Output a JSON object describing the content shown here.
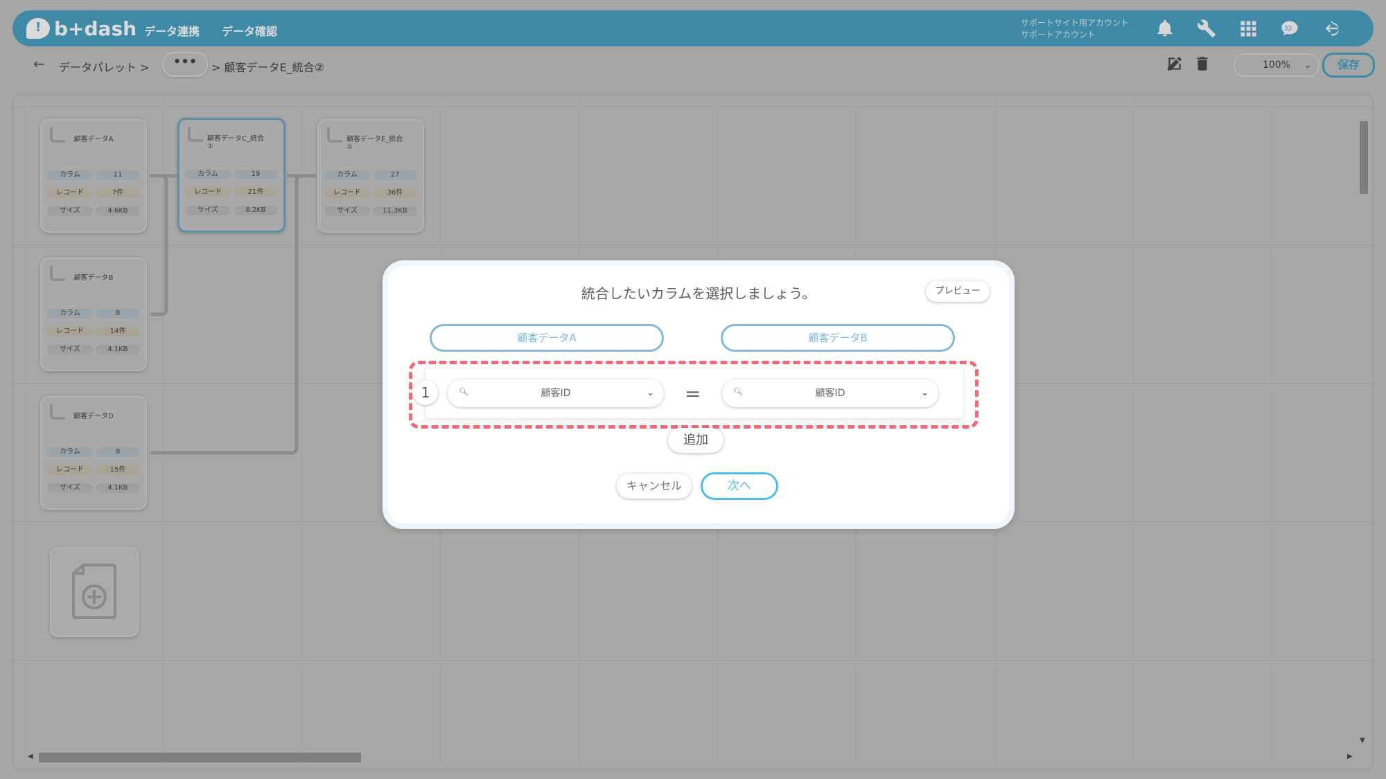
{
  "header": {
    "logo_text": "b+dash",
    "nav": [
      "データ連携",
      "データ確認"
    ],
    "account_line1": "サポートサイト用アカウント",
    "account_line2": "サポートアカウント",
    "badge": "32"
  },
  "toolbar": {
    "breadcrumb_root": "データパレット >",
    "more_label": "•••",
    "breadcrumb_current": "> 顧客データE_統合②",
    "zoom": "100%",
    "save_label": "保存"
  },
  "nodes": [
    {
      "title": "顧客データA",
      "columns": "11",
      "records": "7件",
      "size": "4.6KB"
    },
    {
      "title": "顧客データC_統合①",
      "columns": "19",
      "records": "21件",
      "size": "8.2KB"
    },
    {
      "title": "顧客データE_統合②",
      "columns": "27",
      "records": "36件",
      "size": "11.3KB"
    },
    {
      "title": "顧客データB",
      "columns": "8",
      "records": "14件",
      "size": "4.1KB"
    },
    {
      "title": "顧客データD",
      "columns": "8",
      "records": "15件",
      "size": "4.1KB"
    }
  ],
  "row_labels": {
    "columns": "カラム",
    "records": "レコード",
    "size": "サイズ"
  },
  "modal": {
    "title": "統合したいカラムを選択しましょう。",
    "preview_label": "プレビュー",
    "left_table": "顧客データA",
    "right_table": "顧客データB",
    "row_number": "1",
    "left_column": "顧客ID",
    "right_column": "顧客ID",
    "equals": "=",
    "add_label": "追加",
    "cancel_label": "キャンセル",
    "next_label": "次へ"
  }
}
